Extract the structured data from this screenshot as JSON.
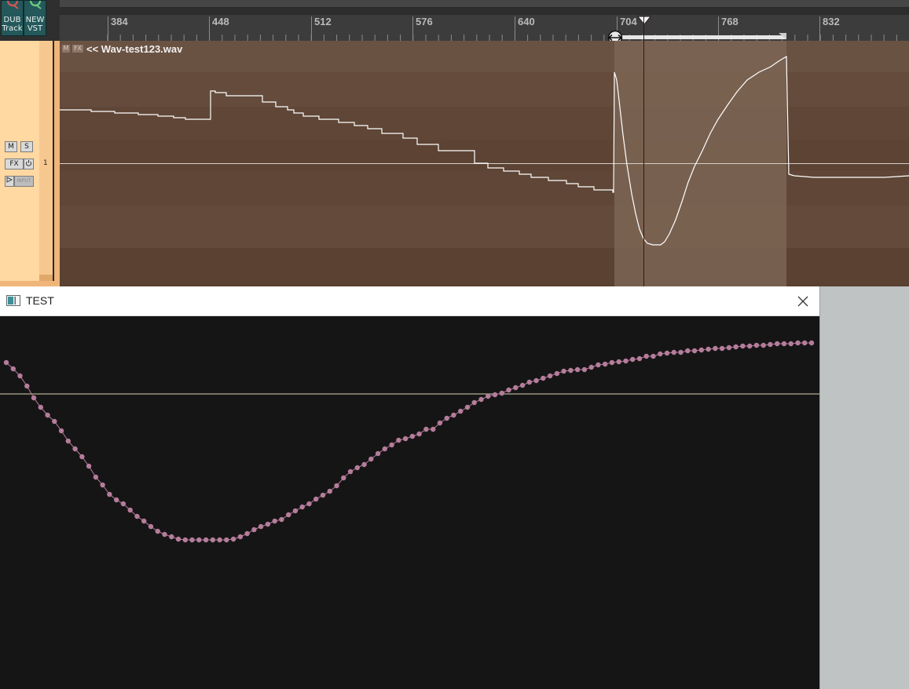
{
  "toolbar": {
    "buttons": [
      {
        "line1": "DUB",
        "line2": "Track",
        "icon": "q-icon"
      },
      {
        "line1": "NEW",
        "line2": "VST",
        "icon": "q-icon"
      }
    ]
  },
  "ruler": {
    "labels": [
      "384",
      "448",
      "512",
      "576",
      "640",
      "704",
      "768",
      "832"
    ]
  },
  "track": {
    "mute": "M",
    "solo": "S",
    "fx": "FX",
    "input": "INPUT",
    "number": "1"
  },
  "clip": {
    "badge_m": "M",
    "badge_fx": "FX",
    "title": "<< Wav-test123.wav"
  },
  "dialog": {
    "title": "TEST",
    "close_icon": "close-icon",
    "app_icon": "window-icon"
  },
  "colors": {
    "clip_bg": "#5e4535",
    "clip_selection": "#7d6555",
    "waveform": "#ffffff",
    "plot_bg": "#161516",
    "plot_points": "#b57d9b",
    "zero_line": "#d9d3b8",
    "track_panel": "#ffd8a2",
    "toolbar_button": "#24585a"
  },
  "chart_data": {
    "type": "scatter",
    "point_count": 118,
    "values": [
      0.6,
      0.68,
      0.77,
      0.9,
      1.05,
      1.17,
      1.27,
      1.35,
      1.47,
      1.6,
      1.7,
      1.8,
      1.92,
      2.06,
      2.16,
      2.28,
      2.35,
      2.4,
      2.48,
      2.56,
      2.62,
      2.69,
      2.75,
      2.79,
      2.82,
      2.85,
      2.86,
      2.86,
      2.86,
      2.86,
      2.86,
      2.86,
      2.86,
      2.85,
      2.82,
      2.78,
      2.73,
      2.69,
      2.66,
      2.62,
      2.6,
      2.54,
      2.49,
      2.44,
      2.4,
      2.34,
      2.29,
      2.24,
      2.17,
      2.07,
      1.99,
      1.94,
      1.9,
      1.83,
      1.76,
      1.7,
      1.65,
      1.59,
      1.57,
      1.54,
      1.51,
      1.45,
      1.45,
      1.37,
      1.31,
      1.27,
      1.22,
      1.17,
      1.11,
      1.07,
      1.03,
      1.01,
      0.99,
      0.95,
      0.92,
      0.89,
      0.85,
      0.83,
      0.8,
      0.77,
      0.74,
      0.71,
      0.7,
      0.69,
      0.69,
      0.66,
      0.63,
      0.62,
      0.6,
      0.59,
      0.58,
      0.56,
      0.55,
      0.52,
      0.52,
      0.49,
      0.48,
      0.47,
      0.47,
      0.45,
      0.45,
      0.44,
      0.43,
      0.42,
      0.42,
      0.41,
      0.4,
      0.39,
      0.39,
      0.38,
      0.38,
      0.37,
      0.36,
      0.36,
      0.36,
      0.35,
      0.35,
      0.35
    ],
    "zero_line": 1.0,
    "ylim": [
      0,
      4.76
    ],
    "xlabel": "",
    "ylabel": "",
    "title": ""
  }
}
